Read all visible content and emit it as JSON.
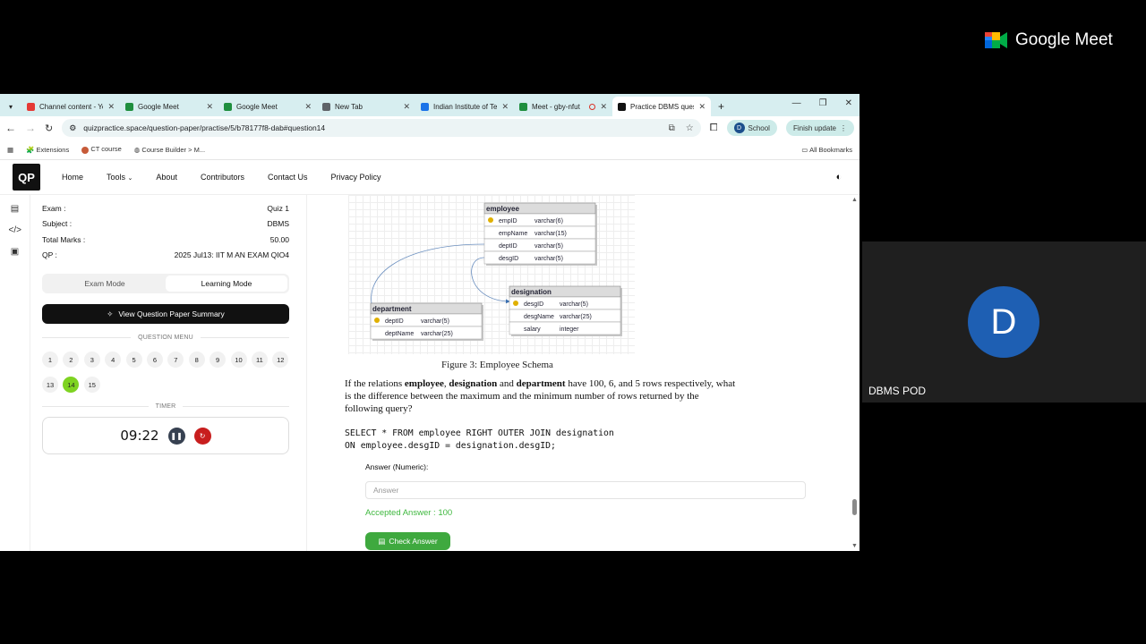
{
  "meet": {
    "logo_text": "Google Meet",
    "participant_initial": "D",
    "participant_name": "DBMS POD"
  },
  "tabs": [
    {
      "title": "Channel content - YouTube",
      "color": "#e53935"
    },
    {
      "title": "Google Meet",
      "color": "#1e8e3e"
    },
    {
      "title": "Google Meet",
      "color": "#1e8e3e"
    },
    {
      "title": "New Tab",
      "color": "#5f6368"
    },
    {
      "title": "Indian Institute of Technology",
      "color": "#1a73e8"
    },
    {
      "title": "Meet - gby-nfut",
      "color": "#1e8e3e"
    },
    {
      "title": "Practice DBMS questions",
      "color": "#111111"
    }
  ],
  "browser": {
    "url": "quizpractice.space/question-paper/practise/5/b78177f8-dab#question14",
    "profile_initial": "D",
    "profile_label": "School",
    "update_label": "Finish update",
    "bookmarks": [
      "Extensions",
      "CT course",
      "Course Builder > M..."
    ],
    "all_bookmarks": "All Bookmarks"
  },
  "site": {
    "logo": "QP",
    "nav": [
      "Home",
      "Tools",
      "About",
      "Contributors",
      "Contact Us",
      "Privacy Policy"
    ]
  },
  "exam": {
    "rows": [
      {
        "key": "Exam :",
        "value": "Quiz 1"
      },
      {
        "key": "Subject :",
        "value": "DBMS"
      },
      {
        "key": "Total Marks :",
        "value": "50.00"
      },
      {
        "key": "QP :",
        "value": "2025 Jul13: IIT M AN EXAM QIO4"
      }
    ],
    "modes": [
      "Exam Mode",
      "Learning Mode"
    ],
    "summary_button": "View Question Paper Summary",
    "menu_label": "QUESTION MENU",
    "questions": [
      "1",
      "2",
      "3",
      "4",
      "5",
      "6",
      "7",
      "8",
      "9",
      "10",
      "11",
      "12",
      "13",
      "14",
      "15"
    ],
    "current_question": "14",
    "timer_label": "TIMER",
    "timer_value": "09:22"
  },
  "diagram": {
    "employee": {
      "name": "employee",
      "rows": [
        [
          "empID",
          "varchar(6)"
        ],
        [
          "empName",
          "varchar(15)"
        ],
        [
          "deptID",
          "varchar(5)"
        ],
        [
          "desgID",
          "varchar(5)"
        ]
      ]
    },
    "designation": {
      "name": "designation",
      "rows": [
        [
          "desgID",
          "varchar(5)"
        ],
        [
          "desgName",
          "varchar(25)"
        ],
        [
          "salary",
          "integer"
        ]
      ]
    },
    "department": {
      "name": "department",
      "rows": [
        [
          "deptID",
          "varchar(5)"
        ],
        [
          "deptName",
          "varchar(25)"
        ]
      ]
    }
  },
  "question": {
    "caption": "Figure 3: Employee Schema",
    "text_1": "If the relations ",
    "rel_1": "employee",
    "sep_1": ", ",
    "rel_2": "designation",
    "sep_2": " and ",
    "rel_3": "department",
    "text_2": " have 100, 6, and 5 rows respectively, what is the difference between the maximum and the minimum number of rows returned by the following query?",
    "query_line_1": "SELECT * FROM employee RIGHT OUTER JOIN designation",
    "query_line_2": "ON employee.desgID = designation.desgID;",
    "answer_label": "Answer (Numeric):",
    "answer_placeholder": "Answer",
    "accepted_answer": "Accepted Answer : 100",
    "check_button": "Check Answer"
  }
}
